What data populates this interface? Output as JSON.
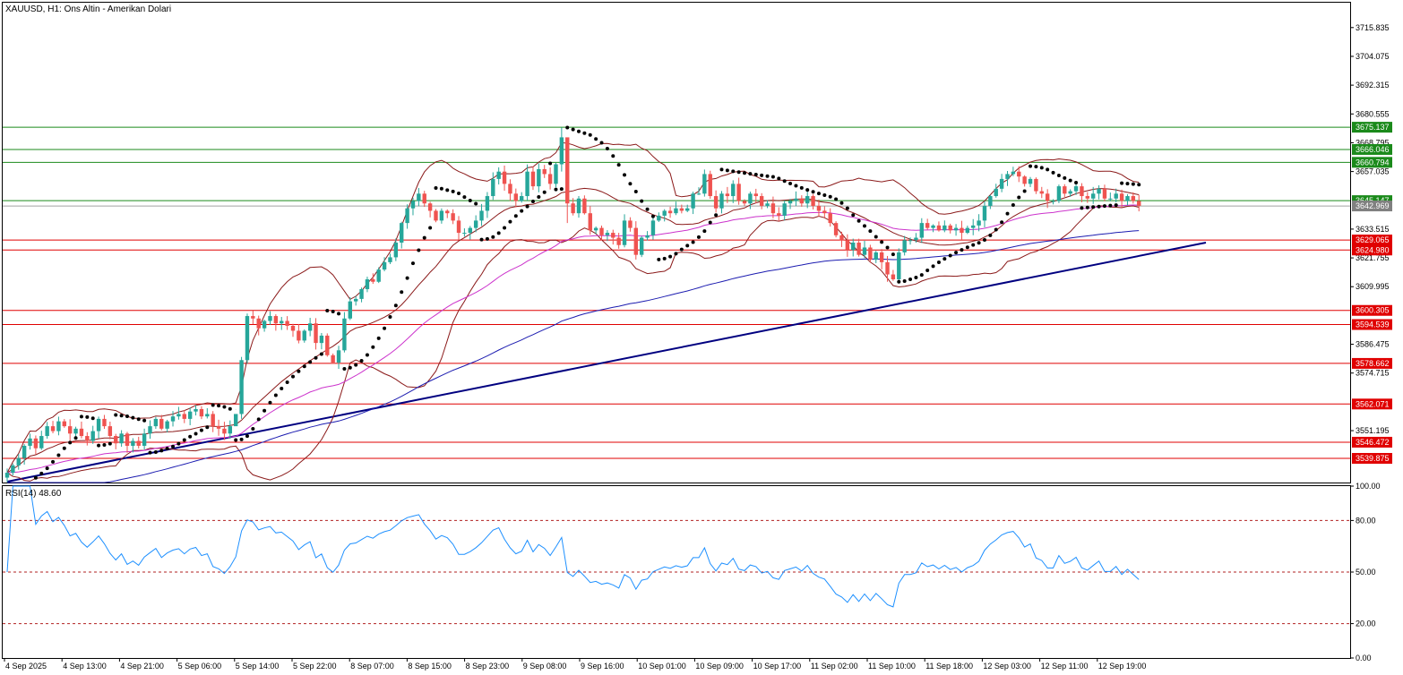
{
  "chart_title": "XAUUSD, H1:  Ons Altin - Amerikan Dolari",
  "rsi_title": "RSI(14) 48.60",
  "colors": {
    "up_candle": "#26a69a",
    "down_candle": "#ef5350",
    "resistance_line": "#1b8a1b",
    "support_line": "#e00000",
    "trend_line": "#000080",
    "bollinger": "#8b1a1a",
    "ma_fast": "#cc33cc",
    "ma_slow": "#1c1cb0",
    "sar": "#000000",
    "rsi": "#1e90ff",
    "rsi_levels": "#b22222",
    "current_price_badge": "#808080"
  },
  "chart_data": [
    {
      "type": "candlestick",
      "symbol": "XAUUSD",
      "timeframe": "H1",
      "ylim": [
        3530.0,
        3726.0
      ],
      "y_ticks": [
        "3715.835",
        "3704.075",
        "3692.315",
        "3680.555",
        "3668.795",
        "3657.035",
        "3633.515",
        "3621.755",
        "3609.995",
        "3586.475",
        "3574.715",
        "3551.195"
      ],
      "x_ticks": [
        "4 Sep 2025",
        "4 Sep 13:00",
        "4 Sep 21:00",
        "5 Sep 06:00",
        "5 Sep 14:00",
        "5 Sep 22:00",
        "8 Sep 07:00",
        "8 Sep 15:00",
        "8 Sep 23:00",
        "9 Sep 08:00",
        "9 Sep 16:00",
        "10 Sep 01:00",
        "10 Sep 09:00",
        "10 Sep 17:00",
        "11 Sep 02:00",
        "11 Sep 10:00",
        "11 Sep 18:00",
        "12 Sep 03:00",
        "12 Sep 11:00",
        "12 Sep 19:00"
      ],
      "resistance_levels": [
        {
          "label": "3675.137",
          "value": 3675.137
        },
        {
          "label": "3666.046",
          "value": 3666.046
        },
        {
          "label": "3660.794",
          "value": 3660.794
        },
        {
          "label": "3645.147",
          "value": 3645.147
        }
      ],
      "support_levels": [
        {
          "label": "3629.065",
          "value": 3629.065
        },
        {
          "label": "3624.980",
          "value": 3624.98
        },
        {
          "label": "3600.305",
          "value": 3600.305
        },
        {
          "label": "3594.539",
          "value": 3594.539
        },
        {
          "label": "3578.662",
          "value": 3578.662
        },
        {
          "label": "3562.071",
          "value": 3562.071
        },
        {
          "label": "3546.472",
          "value": 3546.472
        },
        {
          "label": "3539.875",
          "value": 3539.875
        }
      ],
      "current_price": {
        "label": "3642.969",
        "value": 3642.969
      },
      "closes": [
        3534,
        3537,
        3540,
        3545,
        3548,
        3544,
        3549,
        3553,
        3551,
        3555,
        3553,
        3550,
        3552,
        3549,
        3547,
        3551,
        3556,
        3553,
        3549,
        3546,
        3550,
        3545,
        3547,
        3545,
        3550,
        3553,
        3556,
        3552,
        3555,
        3557,
        3558,
        3556,
        3559,
        3560,
        3557,
        3558,
        3553,
        3552,
        3550,
        3553,
        3558,
        3580,
        3598,
        3597,
        3593,
        3596,
        3598,
        3595,
        3596,
        3594,
        3592,
        3588,
        3592,
        3595,
        3587,
        3590,
        3582,
        3579,
        3584,
        3597,
        3604,
        3605,
        3609,
        3613,
        3612,
        3617,
        3620,
        3622,
        3628,
        3636,
        3642,
        3645,
        3648,
        3644,
        3641,
        3637,
        3641,
        3640,
        3637,
        3632,
        3632,
        3634,
        3637,
        3641,
        3647,
        3654,
        3657,
        3652,
        3648,
        3645,
        3647,
        3657,
        3651,
        3658,
        3656,
        3652,
        3660,
        3671,
        3644,
        3640,
        3646,
        3640,
        3633,
        3634,
        3631,
        3632,
        3630,
        3627,
        3637,
        3634,
        3623,
        3630,
        3631,
        3637,
        3639,
        3641,
        3640,
        3642,
        3641,
        3642,
        3648,
        3648,
        3656,
        3647,
        3642,
        3648,
        3647,
        3652,
        3645,
        3644,
        3648,
        3647,
        3643,
        3644,
        3640,
        3639,
        3644,
        3645,
        3646,
        3644,
        3647,
        3643,
        3641,
        3640,
        3636,
        3631,
        3629,
        3625,
        3628,
        3623,
        3626,
        3621,
        3624,
        3620,
        3615,
        3613,
        3624,
        3629,
        3629,
        3630,
        3636,
        3634,
        3635,
        3633,
        3635,
        3633,
        3634,
        3632,
        3634,
        3635,
        3637,
        3643,
        3647,
        3650,
        3654,
        3656,
        3657,
        3655,
        3652,
        3654,
        3649,
        3648,
        3645,
        3645,
        3651,
        3648,
        3649,
        3651,
        3647,
        3646,
        3648,
        3650,
        3646,
        3646,
        3648,
        3645,
        3647,
        3645,
        3643
      ]
    },
    {
      "type": "line",
      "indicator": "RSI(14)",
      "ylim": [
        0,
        100
      ],
      "y_ticks": [
        "100.00",
        "80.00",
        "50.00",
        "20.00",
        "0.00"
      ],
      "levels": [
        80,
        50,
        20
      ]
    }
  ]
}
